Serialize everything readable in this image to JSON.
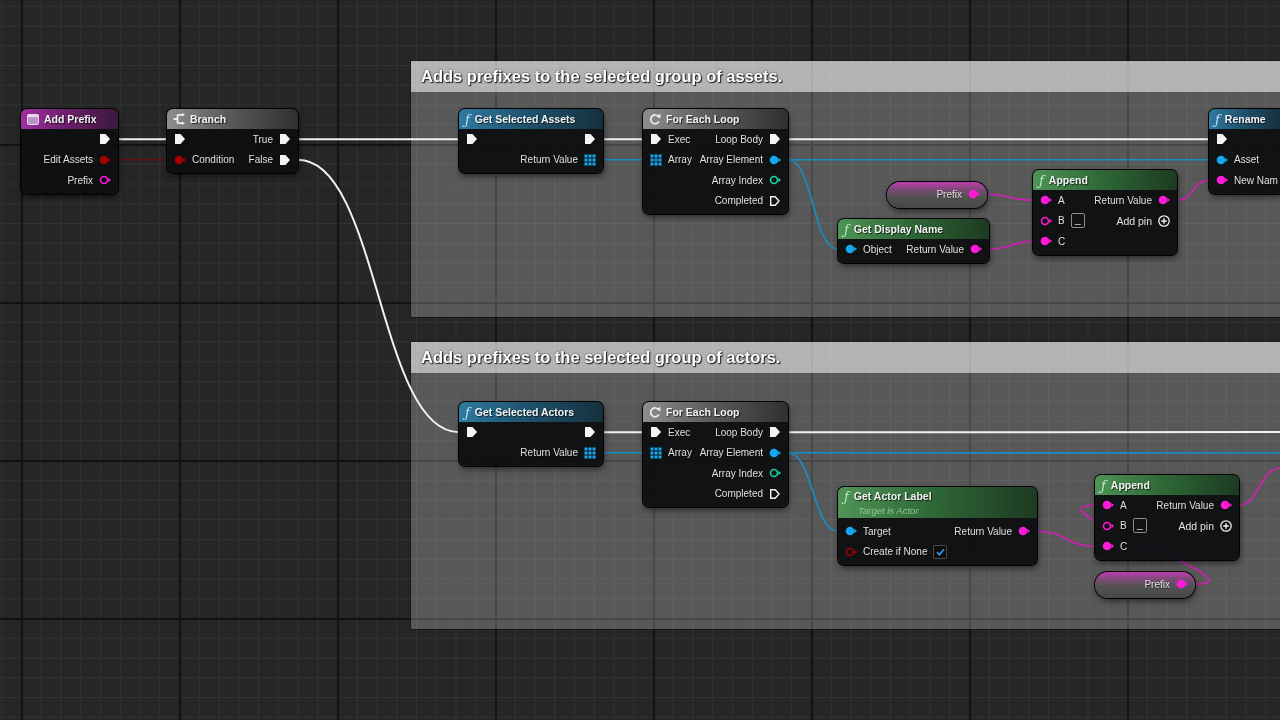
{
  "nodes": [
    {
      "kind": "event",
      "title": "Add Prefix",
      "rows": [
        {
          "output": {
            "kind": "exec",
            "connected": true
          }
        },
        {
          "output": {
            "kind": "bool",
            "label": "Edit Assets",
            "connected": true
          }
        },
        {
          "output": {
            "kind": "string",
            "label": "Prefix",
            "connected": false
          }
        }
      ]
    },
    {
      "kind": "branch",
      "title": "Branch",
      "rows": [
        {
          "input": {
            "kind": "exec",
            "connected": true
          },
          "output": {
            "kind": "exec",
            "label": "True",
            "connected": true
          }
        },
        {
          "input": {
            "kind": "bool",
            "label": "Condition",
            "connected": true
          },
          "output": {
            "kind": "exec",
            "label": "False",
            "connected": true
          }
        }
      ]
    }
  ],
  "comments": [
    {
      "title": "Adds prefixes to the selected group of assets.",
      "nodes": [
        {
          "kind": "function",
          "glyph": "ƒ",
          "title": "Get Selected Assets",
          "rows": [
            {
              "input": {
                "kind": "exec",
                "connected": true
              },
              "output": {
                "kind": "exec",
                "connected": true
              }
            },
            {
              "output": {
                "kind": "array",
                "label": "Return Value",
                "connected": true
              }
            }
          ]
        },
        {
          "kind": "macro",
          "title": "For Each Loop",
          "rows": [
            {
              "input": {
                "kind": "exec",
                "label": "Exec",
                "connected": true
              },
              "output": {
                "kind": "exec",
                "label": "Loop Body",
                "connected": true
              }
            },
            {
              "input": {
                "kind": "array",
                "label": "Array",
                "connected": true
              },
              "output": {
                "kind": "object",
                "label": "Array Element",
                "connected": true
              }
            },
            {
              "output": {
                "kind": "int",
                "label": "Array Index",
                "connected": false
              }
            },
            {
              "output": {
                "kind": "exec",
                "label": "Completed",
                "connected": false
              }
            }
          ]
        },
        {
          "kind": "variable",
          "rows": [
            {
              "output": {
                "kind": "string",
                "label": "Prefix",
                "connected": true
              }
            }
          ]
        },
        {
          "kind": "pure",
          "glyph": "ƒ",
          "title": "Get Display Name",
          "rows": [
            {
              "input": {
                "kind": "object",
                "label": "Object",
                "connected": true
              },
              "output": {
                "kind": "string",
                "label": "Return Value",
                "connected": true
              }
            }
          ]
        },
        {
          "kind": "pure",
          "glyph": "ƒ",
          "title": "Append",
          "rows": [
            {
              "input": {
                "kind": "string",
                "label": "A",
                "connected": true
              },
              "output": {
                "kind": "string",
                "label": "Return Value",
                "connected": true
              }
            },
            {
              "input": {
                "kind": "string",
                "label": "B",
                "connected": false,
                "value": "_"
              },
              "output": {
                "kind": "add",
                "label": "Add pin"
              }
            },
            {
              "input": {
                "kind": "string",
                "label": "C",
                "connected": true
              }
            }
          ]
        },
        {
          "kind": "function",
          "glyph": "ƒ",
          "title": "Rename",
          "rows": [
            {
              "input": {
                "kind": "exec",
                "connected": true
              }
            },
            {
              "input": {
                "kind": "object",
                "label": "Asset",
                "connected": true
              }
            },
            {
              "input": {
                "kind": "string",
                "label": "New Nam",
                "connected": true
              }
            }
          ]
        }
      ]
    },
    {
      "title": "Adds prefixes to the selected group of actors.",
      "nodes": [
        {
          "kind": "function",
          "glyph": "ƒ",
          "title": "Get Selected Actors",
          "rows": [
            {
              "input": {
                "kind": "exec",
                "connected": true
              },
              "output": {
                "kind": "exec",
                "connected": true
              }
            },
            {
              "output": {
                "kind": "array",
                "label": "Return Value",
                "connected": true
              }
            }
          ]
        },
        {
          "kind": "macro",
          "title": "For Each Loop",
          "rows": [
            {
              "input": {
                "kind": "exec",
                "label": "Exec",
                "connected": true
              },
              "output": {
                "kind": "exec",
                "label": "Loop Body",
                "connected": true
              }
            },
            {
              "input": {
                "kind": "array",
                "label": "Array",
                "connected": true
              },
              "output": {
                "kind": "object",
                "label": "Array Element",
                "connected": true
              }
            },
            {
              "output": {
                "kind": "int",
                "label": "Array Index",
                "connected": false
              }
            },
            {
              "output": {
                "kind": "exec",
                "label": "Completed",
                "connected": false
              }
            }
          ]
        },
        {
          "kind": "pure",
          "glyph": "ƒ",
          "title": "Get Actor Label",
          "subtitle": "Target is Actor",
          "rows": [
            {
              "input": {
                "kind": "object",
                "label": "Target",
                "connected": true
              },
              "output": {
                "kind": "string",
                "label": "Return Value",
                "connected": true
              }
            },
            {
              "input": {
                "kind": "bool",
                "label": "Create if None",
                "connected": false,
                "checked": true
              }
            }
          ]
        },
        {
          "kind": "pure",
          "glyph": "ƒ",
          "title": "Append",
          "rows": [
            {
              "input": {
                "kind": "string",
                "label": "A",
                "connected": true
              },
              "output": {
                "kind": "string",
                "label": "Return Value",
                "connected": true
              }
            },
            {
              "input": {
                "kind": "string",
                "label": "B",
                "connected": false,
                "value": "_"
              },
              "output": {
                "kind": "add",
                "label": "Add pin"
              }
            },
            {
              "input": {
                "kind": "string",
                "label": "C",
                "connected": true
              }
            }
          ]
        },
        {
          "kind": "variable",
          "rows": [
            {
              "output": {
                "kind": "string",
                "label": "Prefix",
                "connected": true
              }
            }
          ]
        }
      ]
    }
  ]
}
